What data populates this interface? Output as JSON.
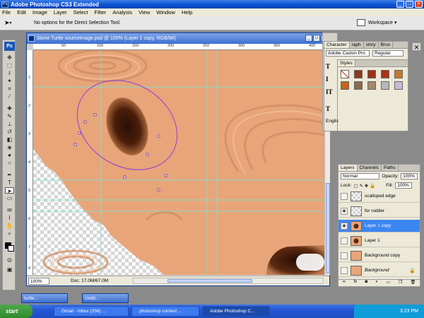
{
  "app": {
    "title": "Adobe Photoshop CS3 Extended",
    "logo": "Ps"
  },
  "menu": [
    "File",
    "Edit",
    "Image",
    "Layer",
    "Select",
    "Filter",
    "Analysis",
    "View",
    "Window",
    "Help"
  ],
  "options": {
    "text": "No options for the Direct Selection Tool.",
    "workspace_label": "Workspace ▾"
  },
  "document": {
    "title": "Stone Turtle sourceimage.psd @ 100% (Layer 1 copy, RGB/8#)",
    "zoom": "100%",
    "doc_info": "Doc: 17.0M/67.0M",
    "ruler_top": [
      "50",
      "100",
      "150",
      "200",
      "250",
      "300",
      "350",
      "400"
    ],
    "ruler_left": [
      "1",
      "2",
      "3",
      "4",
      "5",
      "6",
      "7",
      "8"
    ]
  },
  "char_panel": {
    "tabs": [
      "Character",
      "raph",
      "story",
      "Brus"
    ],
    "font": "Adobe Caslon Pro",
    "style": "Regular",
    "language": "Englis"
  },
  "styles_panel": {
    "tab": "Styles",
    "swatches": [
      "#ffffff",
      "#8b3a1a",
      "#9b3318",
      "#a8321b",
      "#c47a2a",
      "#c46418",
      "#8a6a4e",
      "#a88868",
      "#b8b8b8",
      "#c9b7d9"
    ]
  },
  "layers_panel": {
    "tabs": [
      "Layers",
      "Channels",
      "Paths"
    ],
    "blend_mode": "Normal",
    "opacity_label": "Opacity:",
    "opacity": "100%",
    "lock_label": "Lock:",
    "fill_label": "Fill:",
    "fill": "100%",
    "layers": [
      {
        "name": "scalloped edge",
        "visible": false,
        "thumb": "checker",
        "selected": false,
        "italic": false
      },
      {
        "name": "for rudder",
        "visible": true,
        "thumb": "checker",
        "selected": false,
        "italic": false
      },
      {
        "name": "Layer 1 copy",
        "visible": true,
        "thumb": "dark",
        "selected": true,
        "italic": false
      },
      {
        "name": "Layer 1",
        "visible": false,
        "thumb": "dark",
        "selected": false,
        "italic": false
      },
      {
        "name": "Background copy",
        "visible": false,
        "thumb": "skin",
        "selected": false,
        "italic": false
      },
      {
        "name": "Background",
        "visible": false,
        "thumb": "skin",
        "selected": false,
        "italic": true
      }
    ]
  },
  "minimized": [
    "turtle...",
    "Untitl..."
  ],
  "taskbar": {
    "start": "start",
    "tasks": [
      "Gmail - Inbox (256) ...",
      "photoshop contest ...",
      "Adobe Photoshop C..."
    ],
    "clock": "3:23 PM"
  },
  "colors": {
    "skin": "#e8a57a",
    "guide": "#7de0d0",
    "path": "#9b4fc8",
    "selected_layer": "#3b86f0"
  }
}
